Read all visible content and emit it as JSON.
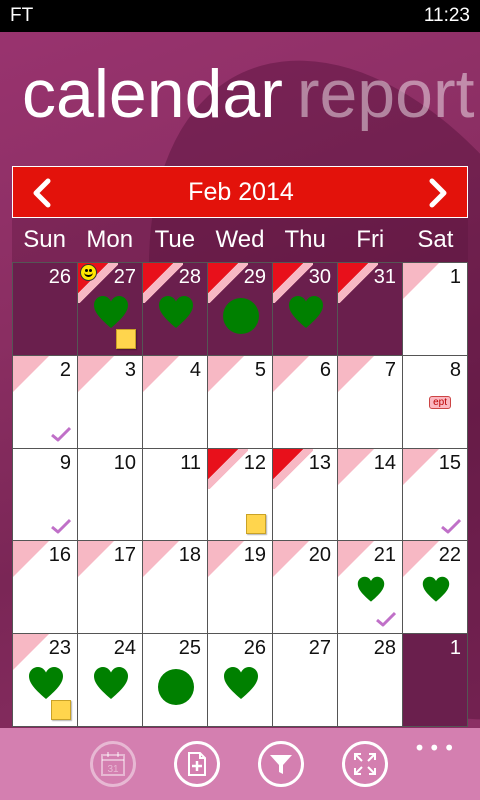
{
  "status": {
    "carrier": "FT",
    "time": "11:23"
  },
  "panorama": {
    "active": "calendar",
    "next": "report"
  },
  "calendar": {
    "month_label": "Feb 2014",
    "weekdays": [
      "Sun",
      "Mon",
      "Tue",
      "Wed",
      "Thu",
      "Fri",
      "Sat"
    ],
    "days": [
      {
        "n": "26",
        "dim": true
      },
      {
        "n": "27",
        "dim": true,
        "tri": "red",
        "smiley": true,
        "marks": [
          "heart",
          "note"
        ]
      },
      {
        "n": "28",
        "dim": true,
        "tri": "red",
        "marks": [
          "heart"
        ]
      },
      {
        "n": "29",
        "dim": true,
        "tri": "red",
        "marks": [
          "circle"
        ]
      },
      {
        "n": "30",
        "dim": true,
        "tri": "red",
        "marks": [
          "heart"
        ]
      },
      {
        "n": "31",
        "dim": true,
        "tri": "red"
      },
      {
        "n": "1",
        "tri": "pink"
      },
      {
        "n": "2",
        "tri": "pink",
        "marks": [
          "check"
        ]
      },
      {
        "n": "3",
        "tri": "pink"
      },
      {
        "n": "4",
        "tri": "pink"
      },
      {
        "n": "5",
        "tri": "pink"
      },
      {
        "n": "6",
        "tri": "pink"
      },
      {
        "n": "7",
        "tri": "pink"
      },
      {
        "n": "8",
        "tag": "ept"
      },
      {
        "n": "9",
        "marks": [
          "check"
        ]
      },
      {
        "n": "10"
      },
      {
        "n": "11"
      },
      {
        "n": "12",
        "tri": "red",
        "marks": [
          "note"
        ]
      },
      {
        "n": "13",
        "tri": "red"
      },
      {
        "n": "14",
        "tri": "pink"
      },
      {
        "n": "15",
        "tri": "pink",
        "marks": [
          "check"
        ]
      },
      {
        "n": "16",
        "tri": "pink"
      },
      {
        "n": "17",
        "tri": "pink"
      },
      {
        "n": "18",
        "tri": "pink"
      },
      {
        "n": "19",
        "tri": "pink"
      },
      {
        "n": "20",
        "tri": "pink"
      },
      {
        "n": "21",
        "tri": "pink",
        "marks": [
          "heart-sm",
          "check"
        ]
      },
      {
        "n": "22",
        "tri": "pink",
        "marks": [
          "heart-sm"
        ]
      },
      {
        "n": "23",
        "tri": "pink",
        "marks": [
          "heart",
          "note"
        ]
      },
      {
        "n": "24",
        "marks": [
          "heart"
        ]
      },
      {
        "n": "25",
        "marks": [
          "circle"
        ]
      },
      {
        "n": "26",
        "marks": [
          "heart"
        ]
      },
      {
        "n": "27"
      },
      {
        "n": "28"
      },
      {
        "n": "1",
        "dim": true
      }
    ]
  },
  "colors": {
    "header_red": "#e3120b",
    "period_red": "#e8101b",
    "fertile_pink": "#f7b8c4",
    "mark_green": "#008000",
    "background_plum": "#8a2e62",
    "app_bar": "#d47fb0"
  },
  "app_bar": {
    "buttons": [
      {
        "icon": "calendar-today-icon",
        "day": "31",
        "enabled": false
      },
      {
        "icon": "add-note-icon",
        "enabled": true
      },
      {
        "icon": "filter-icon",
        "enabled": true
      },
      {
        "icon": "expand-icon",
        "enabled": true
      }
    ],
    "more": "•••"
  }
}
